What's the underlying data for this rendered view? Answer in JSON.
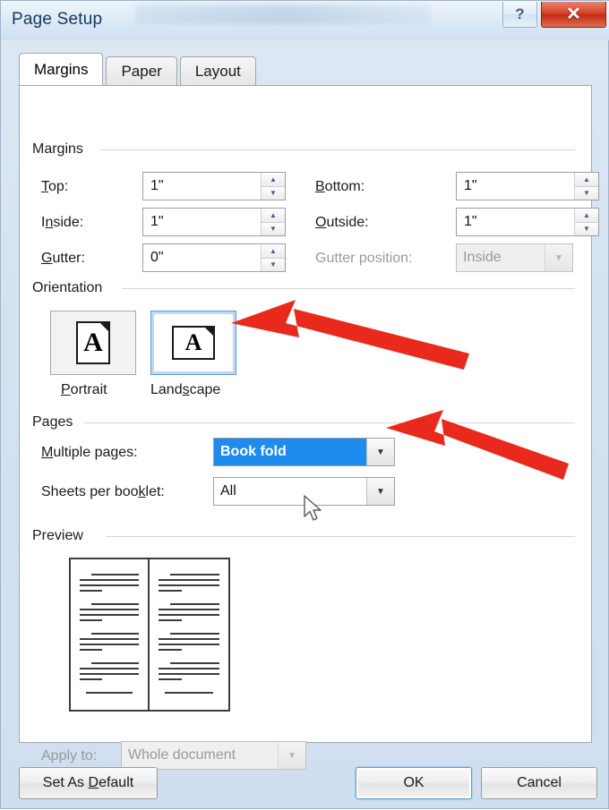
{
  "window": {
    "title": "Page Setup",
    "help_label": "?",
    "close_label": "✕"
  },
  "tabs": [
    {
      "label": "Margins",
      "active": true
    },
    {
      "label": "Paper",
      "active": false
    },
    {
      "label": "Layout",
      "active": false
    }
  ],
  "margins": {
    "group_label": "Margins",
    "fields": [
      {
        "label": "Top:",
        "accel": "T",
        "value": "1\"",
        "disabled": false
      },
      {
        "label": "Bottom:",
        "accel": "B",
        "value": "1\"",
        "disabled": false
      },
      {
        "label": "Inside:",
        "accel": "n",
        "value": "1\"",
        "disabled": false
      },
      {
        "label": "Outside:",
        "accel": "O",
        "value": "1\"",
        "disabled": false
      },
      {
        "label": "Gutter:",
        "accel": "G",
        "value": "0\"",
        "disabled": false
      }
    ],
    "gutter_position": {
      "label": "Gutter position:",
      "value": "Inside",
      "disabled": true
    }
  },
  "orientation": {
    "group_label": "Orientation",
    "options": [
      {
        "label": "Portrait",
        "accel": "P",
        "selected": false,
        "icon": "portrait-page-icon"
      },
      {
        "label": "Landscape",
        "accel": "s",
        "selected": true,
        "icon": "landscape-page-icon"
      }
    ]
  },
  "pages": {
    "group_label": "Pages",
    "multiple_pages": {
      "label": "Multiple pages:",
      "accel": "M",
      "value": "Book fold",
      "selected": true
    },
    "sheets_per_booklet": {
      "label": "Sheets per booklet:",
      "accel": "k",
      "value": "All",
      "selected": false
    }
  },
  "preview": {
    "group_label": "Preview",
    "pages": 2,
    "paragraphs_per_page": 4,
    "lines_per_paragraph": 4
  },
  "apply_to": {
    "label": "Apply to:",
    "value": "Whole document",
    "disabled": true
  },
  "footer": {
    "set_as_default": "Set As Default",
    "ok": "OK",
    "cancel": "Cancel"
  },
  "annotations": {
    "arrow_color": "#e8291c",
    "arrow_1_target": "landscape-orientation-option",
    "arrow_2_target": "multiple-pages-combo",
    "cursor": "arrow-pointer"
  },
  "colors": {
    "accent_blue": "#1e8bef",
    "selection_border": "#5b9bd5",
    "close_red": "#c32a14"
  }
}
